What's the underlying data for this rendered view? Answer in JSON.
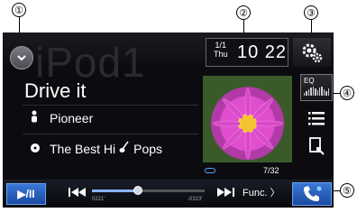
{
  "callouts": [
    "①",
    "②",
    "③",
    "④",
    "⑤"
  ],
  "header": {
    "watermark": "iPod1",
    "date_top": "1/1",
    "date_bottom": "Thu",
    "time": "10 22"
  },
  "track": {
    "title": "Drive it",
    "artist": "Pioneer",
    "album": "The Best Hi",
    "album_tail": "Pops",
    "counter": "7/32"
  },
  "eq": {
    "label": "EQ"
  },
  "controls": {
    "play_label": "▶/II",
    "elapsed": "0221'",
    "remaining": "-0313'",
    "func_label": "Func.",
    "progress_fraction": 0.41
  },
  "icons": {
    "source": "chevron-down-icon",
    "settings": "gear-icon",
    "list": "list-icon",
    "phone_book": "phone-list-icon",
    "phone": "phone-icon",
    "repeat": "repeat-icon"
  },
  "colors": {
    "accent": "#2a62c6",
    "screen_bg": "#0c0c10"
  }
}
